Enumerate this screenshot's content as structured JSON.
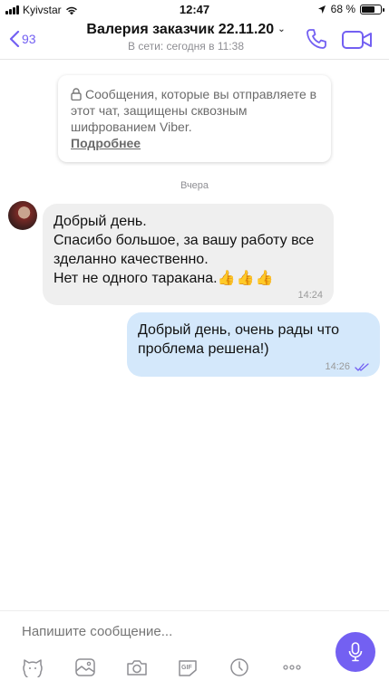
{
  "status_bar": {
    "carrier": "Kyivstar",
    "time": "12:47",
    "battery": "68 %",
    "battery_level": 0.68
  },
  "header": {
    "back_count": "93",
    "title": "Валерия заказчик 22.11.20",
    "subtitle": "В сети: сегодня в 11:38"
  },
  "e2e_notice": {
    "text": "Сообщения, которые вы отправляете в этот чат, защищены сквозным шифрованием Viber.",
    "link": "Подробнее"
  },
  "date_separator": "Вчера",
  "messages": [
    {
      "direction": "incoming",
      "text": "Добрый день.\nСпасибо большое,  за вашу работу все зделанно качественно.\nНет не одного  таракана.",
      "emoji": "👍👍👍",
      "time": "14:24"
    },
    {
      "direction": "outgoing",
      "text": "Добрый день, очень рады что проблема решена!)",
      "time": "14:26",
      "status": "read"
    }
  ],
  "composer": {
    "placeholder": "Напишите сообщение..."
  },
  "toolbar_icons": [
    "sticker-icon",
    "gallery-icon",
    "camera-icon",
    "gif-icon",
    "timer-icon",
    "more-icon"
  ],
  "colors": {
    "accent": "#7360f2",
    "incoming_bubble": "#efefef",
    "outgoing_bubble": "#d4e8fb"
  }
}
